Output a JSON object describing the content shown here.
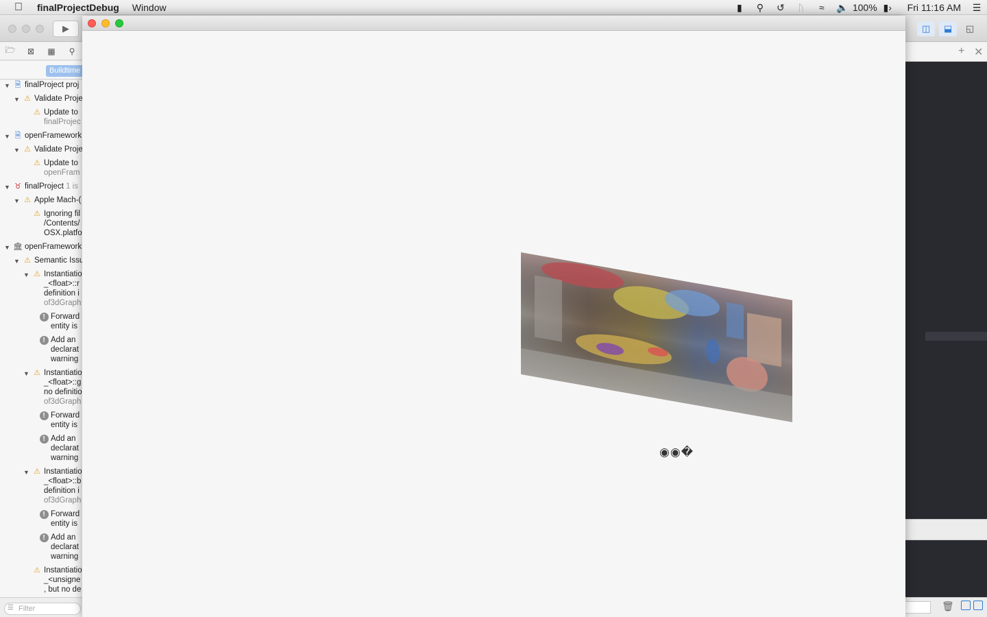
{
  "menubar": {
    "apple_icon": "apple-logo-icon",
    "app_name": "finalProjectDebug",
    "items": [
      "Window"
    ],
    "status": {
      "battery_percent": "100%",
      "clock": "Fri 11:16 AM",
      "icons": [
        "mouse-icon",
        "spotlight-search-icon",
        "time-machine-icon",
        "bluetooth-icon",
        "wifi-icon",
        "volume-icon",
        "battery-icon",
        "notification-center-icon"
      ]
    }
  },
  "xcode": {
    "scope_button": "Buildtime",
    "issues": [
      {
        "level": 0,
        "icon": "project",
        "text": "finalProject proj"
      },
      {
        "level": 1,
        "icon": "warning",
        "text": "Validate Proje"
      },
      {
        "level": 2,
        "icon": "warning",
        "text": "Update to",
        "sub": "finalProjec"
      },
      {
        "level": 0,
        "icon": "project",
        "text": "openFramework"
      },
      {
        "level": 1,
        "icon": "warning",
        "text": "Validate Proje"
      },
      {
        "level": 2,
        "icon": "warning",
        "text": "Update to",
        "sub": "openFram"
      },
      {
        "level": 0,
        "icon": "app",
        "text": "finalProject",
        "count": "1 is"
      },
      {
        "level": 1,
        "icon": "warning",
        "text": "Apple Mach-("
      },
      {
        "level": 2,
        "icon": "warning",
        "text": "Ignoring fil",
        "lines": [
          "/Contents/",
          "OSX.platfo"
        ]
      },
      {
        "level": 0,
        "icon": "library",
        "text": "openFramework"
      },
      {
        "level": 1,
        "icon": "warning",
        "text": "Semantic Issu"
      },
      {
        "level": 2,
        "icon": "warning",
        "text": "Instantiatio",
        "lines": [
          "_<float>::r",
          "definition i"
        ],
        "sub": "of3dGraph"
      },
      {
        "level": 3,
        "icon": "note",
        "text": "Forward",
        "lines": [
          "entity is"
        ]
      },
      {
        "level": 3,
        "icon": "note",
        "text": "Add an",
        "lines": [
          "declarat",
          "warning"
        ]
      },
      {
        "level": 2,
        "icon": "warning",
        "text": "Instantiatio",
        "lines": [
          "_<float>::g",
          "no definitio"
        ],
        "sub": "of3dGraph"
      },
      {
        "level": 3,
        "icon": "note",
        "text": "Forward",
        "lines": [
          "entity is"
        ]
      },
      {
        "level": 3,
        "icon": "note",
        "text": "Add an",
        "lines": [
          "declarat",
          "warning"
        ]
      },
      {
        "level": 2,
        "icon": "warning",
        "text": "Instantiatio",
        "lines": [
          "_<float>::b",
          "definition i"
        ],
        "sub": "of3dGraph"
      },
      {
        "level": 3,
        "icon": "note",
        "text": "Forward",
        "lines": [
          "entity is"
        ]
      },
      {
        "level": 3,
        "icon": "note",
        "text": "Add an",
        "lines": [
          "declarat",
          "warning"
        ]
      },
      {
        "level": 2,
        "icon": "warning",
        "text": "Instantiatio",
        "lines": [
          "_<unsigne",
          ", but no de"
        ]
      }
    ],
    "filter_placeholder": "Filter"
  },
  "app_window": {
    "canvas_objects": [
      "panorama-image",
      "eyes-icon"
    ]
  }
}
